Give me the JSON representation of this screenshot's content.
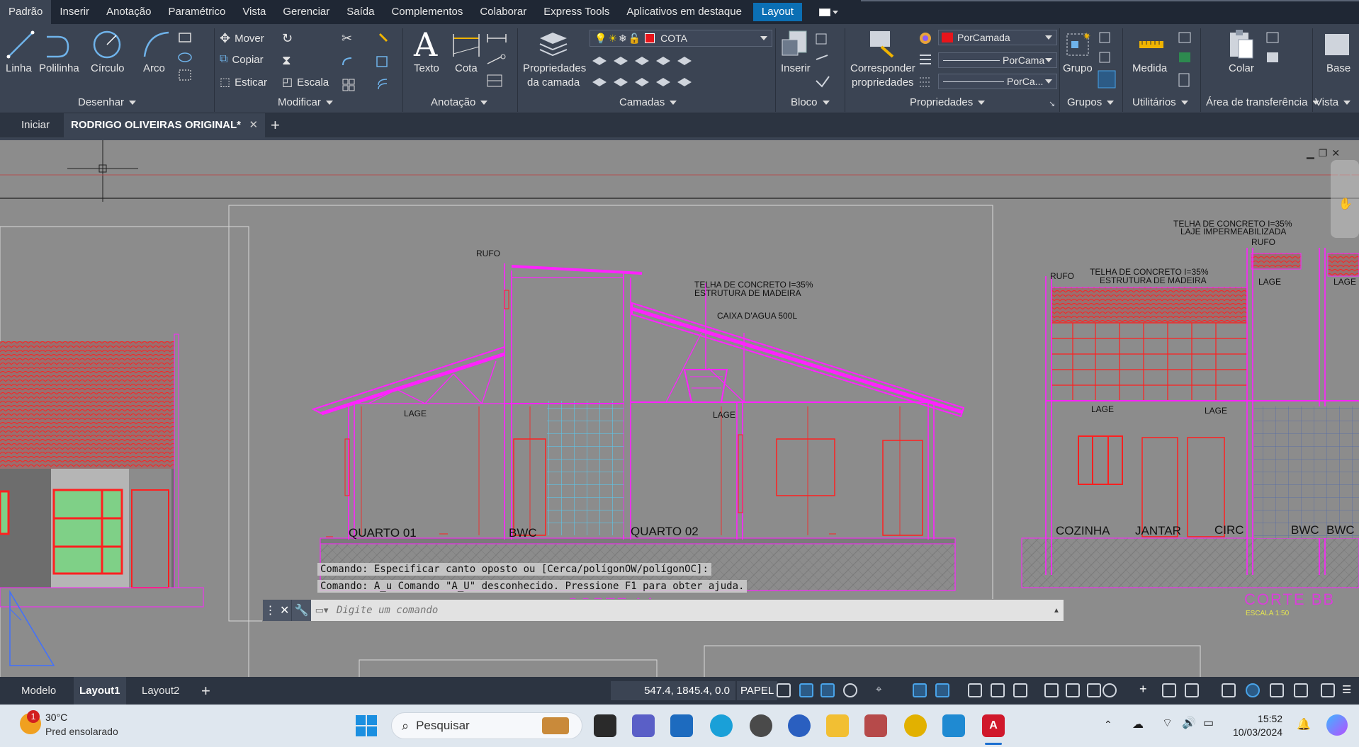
{
  "menu": {
    "tabs": [
      "Padrão",
      "Inserir",
      "Anotação",
      "Paramétrico",
      "Vista",
      "Gerenciar",
      "Saída",
      "Complementos",
      "Colaborar",
      "Express Tools",
      "Aplicativos em destaque",
      "Layout"
    ],
    "active": "Layout"
  },
  "ribbon": {
    "draw": {
      "linha": "Linha",
      "polilinha": "Polilinha",
      "circulo": "Círculo",
      "arco": "Arco",
      "title": "Desenhar"
    },
    "modify": {
      "mover": "Mover",
      "copiar": "Copiar",
      "esticar": "Esticar",
      "escala": "Escala",
      "title": "Modificar"
    },
    "annotation": {
      "texto": "Texto",
      "cota": "Cota",
      "title": "Anotação"
    },
    "layers": {
      "props_line1": "Propriedades",
      "props_line2": "da camada",
      "current_layer": "COTA",
      "current_layer_color": "#e8151b",
      "title": "Camadas"
    },
    "block": {
      "inserir": "Inserir",
      "title": "Bloco"
    },
    "properties": {
      "match_line1": "Corresponder",
      "match_line2": "propriedades",
      "color": "PorCamada",
      "linetype": "PorCama",
      "lineweight": "PorCa...",
      "title": "Propriedades"
    },
    "groups": {
      "grupo": "Grupo",
      "title": "Grupos"
    },
    "utilities": {
      "medida": "Medida",
      "title": "Utilitários"
    },
    "clipboard": {
      "colar": "Colar",
      "title": "Área de transferência"
    },
    "view": {
      "base": "Base",
      "title": "Vista"
    }
  },
  "doc_tabs": {
    "start": "Iniciar",
    "current": "RODRIGO OLIVEIRAS ORIGINAL*",
    "add": "+"
  },
  "drawing": {
    "labels": {
      "rufo": "RUFO",
      "telha1": "TELHA DE CONCRETO  I=35%",
      "estrutura1": "ESTRUTURA  DE MADEIRA",
      "caixa": "CAIXA D'AGUA 500L",
      "lage": "LAGE",
      "quarto01": "QUARTO 01",
      "bwc": "BWC",
      "quarto02": "QUARTO 02",
      "corte_aa": "CORTE  AA",
      "escala": "ESCALA 1:50",
      "telha2": "TELHA DE CONCRETO  I=35%",
      "laje_imp": "LAJE IMPERMEABILIZADA",
      "telha3": "TELHA DE CONCRETO  I=35%",
      "estrutura3": "ESTRUTURA  DE MADEIRA",
      "cozinha": "COZINHA",
      "jantar": "JANTAR",
      "circ": "CIRC",
      "corte_bb": "CORTE  BB"
    }
  },
  "command": {
    "history1": "Comando: Especificar canto oposto ou [Cerca/polígonOW/polígonOC]:",
    "history2": "Comando: A_u Comando \"A_U\" desconhecido. Pressione F1 para obter ajuda.",
    "placeholder": "Digite um comando"
  },
  "status": {
    "layout_tabs": [
      "Modelo",
      "Layout1",
      "Layout2"
    ],
    "active_layout": "Layout1",
    "coords": "547.4, 1845.4, 0.0",
    "space": "PAPEL"
  },
  "taskbar": {
    "weather_temp": "30°C",
    "weather_desc": "Pred ensolarado",
    "weather_badge": "1",
    "search": "Pesquisar",
    "time": "15:52",
    "date": "10/03/2024"
  }
}
